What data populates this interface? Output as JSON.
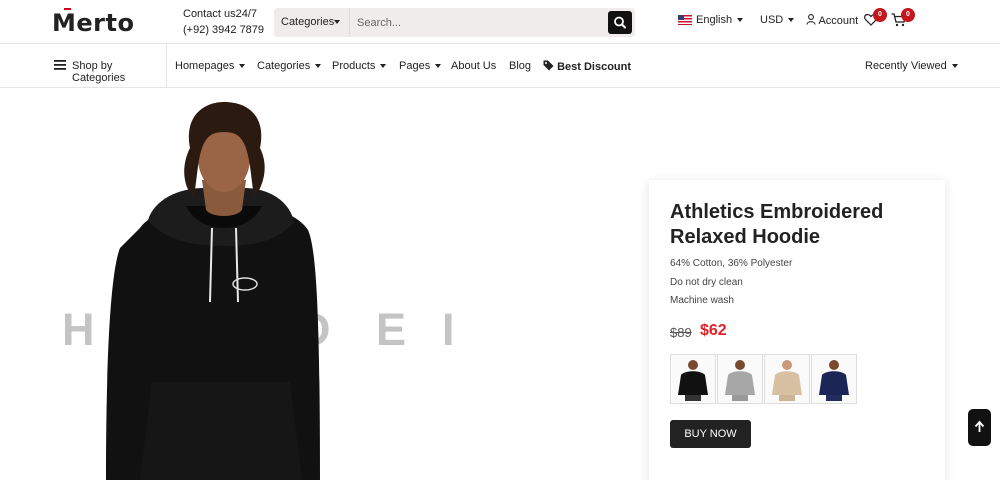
{
  "header": {
    "logo": "Merto",
    "contact_line1": "Contact us24/7",
    "contact_line2": "(+92) 3942 7879",
    "search": {
      "category": "Categories",
      "placeholder": "Search..."
    },
    "language": "English",
    "currency": "USD",
    "account": "Account",
    "wishlist_count": "0",
    "cart_count": "0"
  },
  "nav": {
    "shop_by_categories": "Shop by Categories",
    "items": [
      "Homepages",
      "Categories",
      "Products",
      "Pages",
      "About Us",
      "Blog"
    ],
    "best_discount": "Best Discount",
    "recently_viewed": "Recently Viewed"
  },
  "hero": {
    "background_text": [
      "H",
      "O",
      "O",
      "D",
      "E",
      "I"
    ],
    "product": {
      "title": "Athletics Embroidered Relaxed Hoodie",
      "features": [
        "64% Cotton, 36% Polyester",
        "Do not dry clean",
        "Machine wash"
      ],
      "old_price": "$89",
      "new_price": "$62",
      "variants": [
        "black-hoodie-icon",
        "grey-hoodie-icon",
        "beige-hoodie-icon",
        "navy-hoodie-icon"
      ],
      "buy_label": "BUY NOW"
    }
  },
  "colors": {
    "accent_red": "#e0232a",
    "badge_red": "#c4161c",
    "dark": "#222222"
  }
}
